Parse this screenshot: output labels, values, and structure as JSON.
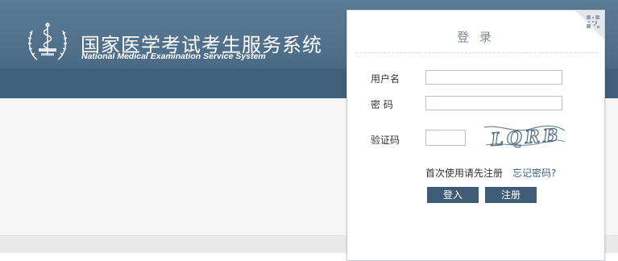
{
  "header": {
    "title_cn": "国家医学考试考生服务系统",
    "title_en": "National Medical Examination Service System"
  },
  "login": {
    "title": "登 录",
    "username_label": "用户名",
    "password_label": "密 码",
    "captcha_label": "验证码",
    "captcha_text": "LQRB",
    "username_value": "",
    "password_value": "",
    "captcha_value": "",
    "first_use_text": "首次使用请先注册",
    "forgot_password_text": "忘记密码?",
    "login_button": "登入",
    "register_button": "注册"
  },
  "colors": {
    "banner": "#4e6e89",
    "button": "#405d78",
    "forgot_link": "#3a5f86"
  },
  "icons": [
    "emblem-icon",
    "qr-code-icon"
  ]
}
